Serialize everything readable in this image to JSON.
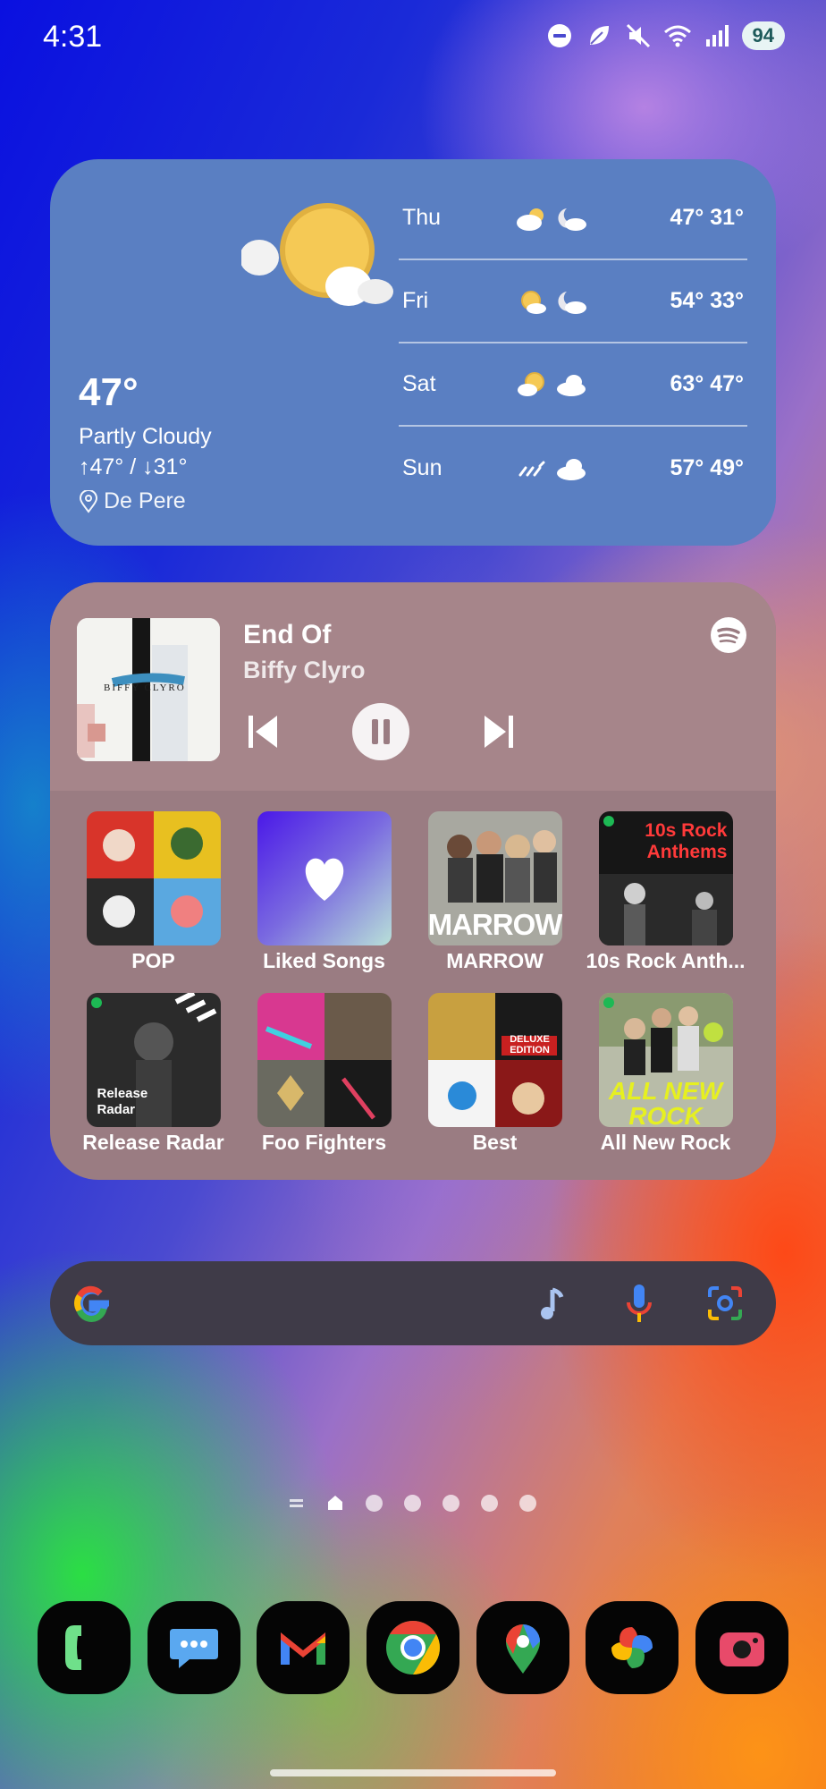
{
  "status_bar": {
    "time": "4:31",
    "battery": "94",
    "icons": [
      "do-not-disturb-icon",
      "leaf-icon",
      "mute-icon",
      "wifi-icon",
      "signal-icon"
    ]
  },
  "weather": {
    "current_temp": "47°",
    "condition": "Partly Cloudy",
    "hi_lo": "↑47° / ↓31°",
    "location": "De Pere",
    "forecast": [
      {
        "day": "Thu",
        "hi_lo": "47° 31°",
        "icons": [
          "partly-cloudy-icon",
          "moon-cloud-icon"
        ]
      },
      {
        "day": "Fri",
        "hi_lo": "54° 33°",
        "icons": [
          "sun-cloud-icon",
          "moon-cloud-icon"
        ]
      },
      {
        "day": "Sat",
        "hi_lo": "63° 47°",
        "icons": [
          "sun-cloud-icon",
          "cloud-icon"
        ]
      },
      {
        "day": "Sun",
        "hi_lo": "57° 49°",
        "icons": [
          "rain-icon",
          "cloud-icon"
        ]
      }
    ]
  },
  "player": {
    "track": "End Of",
    "artist": "Biffy Clyro",
    "album_art_text": "BIFFY CLYRO",
    "playlists": [
      {
        "label": "POP"
      },
      {
        "label": "Liked Songs"
      },
      {
        "label": "MARROW",
        "art_text": "MARROW"
      },
      {
        "label": "10s Rock Anth...",
        "art_text": "10s Rock Anthems"
      },
      {
        "label": "Release Radar",
        "art_text": "Release Radar"
      },
      {
        "label": "Foo Fighters"
      },
      {
        "label": "Best",
        "art_text": "DELUXE EDITION"
      },
      {
        "label": "All New Rock",
        "art_text": "ALL NEW ROCK"
      }
    ]
  },
  "dock": {
    "apps": [
      "phone-icon",
      "messages-icon",
      "gmail-icon",
      "chrome-icon",
      "maps-icon",
      "photos-icon",
      "camera-icon"
    ]
  },
  "colors": {
    "weather_bg": "#5a7fc2",
    "player_bg": "#9a7c82",
    "search_bg": "#3f3b48"
  }
}
